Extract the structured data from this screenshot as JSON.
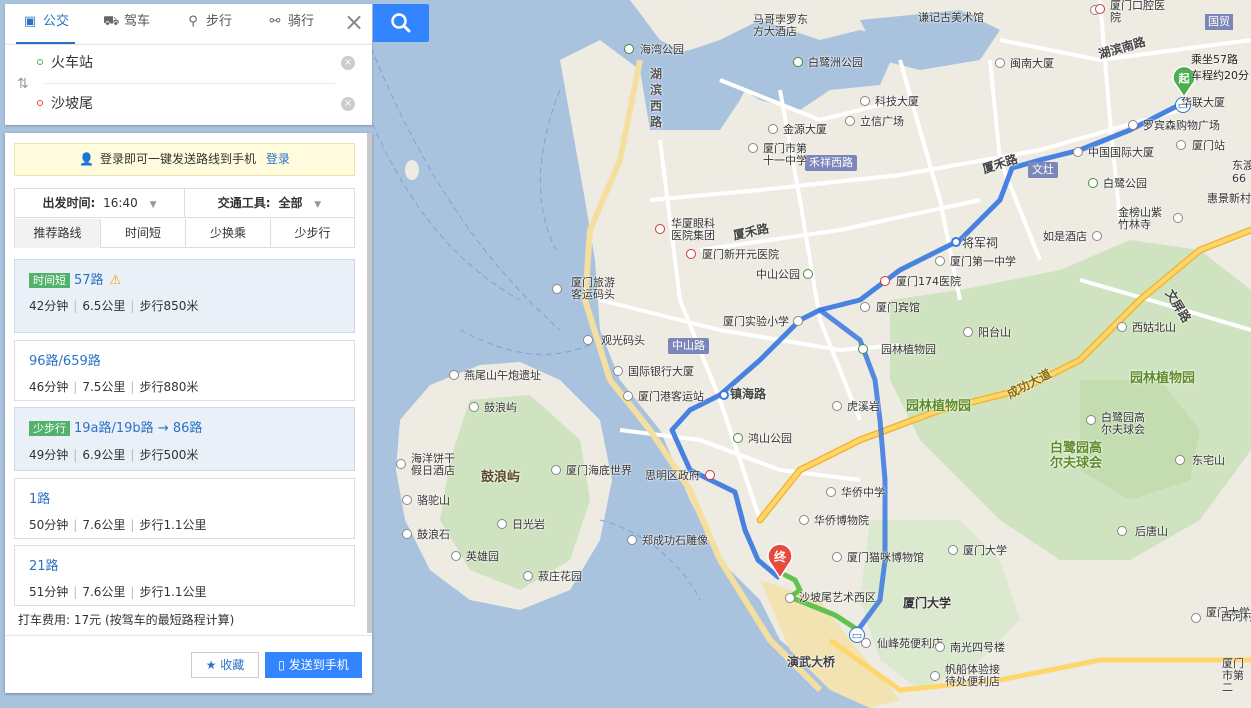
{
  "modes": [
    {
      "label": "公交",
      "icon": "bus-icon",
      "active": true
    },
    {
      "label": "驾车",
      "icon": "car-icon",
      "active": false
    },
    {
      "label": "步行",
      "icon": "walk-icon",
      "active": false
    },
    {
      "label": "骑行",
      "icon": "bike-icon",
      "active": false
    }
  ],
  "search": {
    "start": "火车站",
    "end": "沙坡尾"
  },
  "login_bar": {
    "text": "登录即可一键发送路线到手机",
    "link": "登录"
  },
  "options": {
    "depart_label": "出发时间:",
    "depart_value": "16:40",
    "transport_label": "交通工具:",
    "transport_value": "全部",
    "tabs": [
      "推荐路线",
      "时间短",
      "少换乘",
      "少步行"
    ]
  },
  "routes": [
    {
      "tag": "时间短",
      "name": "57路",
      "warning": true,
      "duration": "42分钟",
      "distance": "6.5公里",
      "walk": "步行850米",
      "selected": true
    },
    {
      "tag": "",
      "name": "96路/659路",
      "warning": false,
      "duration": "46分钟",
      "distance": "7.5公里",
      "walk": "步行880米",
      "selected": false
    },
    {
      "tag": "少步行",
      "name": "19a路/19b路 → 86路",
      "warning": false,
      "duration": "49分钟",
      "distance": "6.9公里",
      "walk": "步行500米",
      "selected": true
    },
    {
      "tag": "",
      "name": "1路",
      "warning": false,
      "duration": "50分钟",
      "distance": "7.6公里",
      "walk": "步行1.1公里",
      "selected": false
    },
    {
      "tag": "",
      "name": "21路",
      "warning": false,
      "duration": "51分钟",
      "distance": "7.6公里",
      "walk": "步行1.1公里",
      "selected": false
    }
  ],
  "taxi": "打车费用: 17元 (按驾车的最短路程计算)",
  "buttons": {
    "favorite": "收藏",
    "send": "发送到手机"
  },
  "map": {
    "start_marker": "起",
    "end_marker": "终",
    "ride_info": [
      "乘坐57路",
      "车程约20分"
    ],
    "corner_tag": "国贸",
    "road_tags": [
      "禾祥西路",
      "文灶",
      "中山路"
    ],
    "roads": [
      "厦禾路",
      "湖滨南路",
      "镇海路",
      "成功大道",
      "文屏路",
      "演武大桥"
    ],
    "vertical_roads": [
      "湖滨西路"
    ],
    "big_labels": [
      "园林植物园",
      "园林植物园",
      "白鹭园高尔夫球会"
    ],
    "island": "鼓浪屿",
    "university": "厦门大学",
    "pois": [
      "谦记古美术馆",
      "马哥孛罗东方大酒店",
      "厦门口腔医院",
      "海湾公园",
      "白鹭洲公园",
      "闽南大厦",
      "科技大厦",
      "立信广场",
      "金源大厦",
      "厦门市第十一中学",
      "罗宾森购物广场",
      "华联大厦",
      "中国国际大厦",
      "厦门站",
      "华厦眼科医院集团",
      "厦门新开元医院",
      "将军祠",
      "厦门第一中学",
      "中山公园",
      "厦门174医院",
      "厦门宾馆",
      "厦门实验小学",
      "厦门旅游客运码头",
      "观光码头",
      "园林植物园",
      "虎溪岩",
      "国际银行大厦",
      "厦门港客运站",
      "鸿山公园",
      "思明区政府",
      "厦门海底世界",
      "燕尾山午炮遗址",
      "鼓浪屿",
      "海洋饼干假日酒店",
      "骆驼山",
      "日光岩",
      "鼓浪石",
      "英雄园",
      "菽庄花园",
      "郑成功石雕像",
      "华侨中学",
      "华侨博物院",
      "厦门猫咪博物馆",
      "厦门大学",
      "沙坡尾艺术西区",
      "仙峰苑便利店",
      "南光四号楼",
      "帆船体验接待处便利店",
      "白鹭园高尔夫球会",
      "东宅山",
      "后唐山",
      "阳台山",
      "西姑北山",
      "如是酒店",
      "金榜山紫竹林寺",
      "白鹭公园",
      "厦门大学生公寓",
      "西河村"
    ],
    "edge_labels": [
      "东渡",
      "惠景新村",
      "厦门市第二",
      "66"
    ]
  }
}
